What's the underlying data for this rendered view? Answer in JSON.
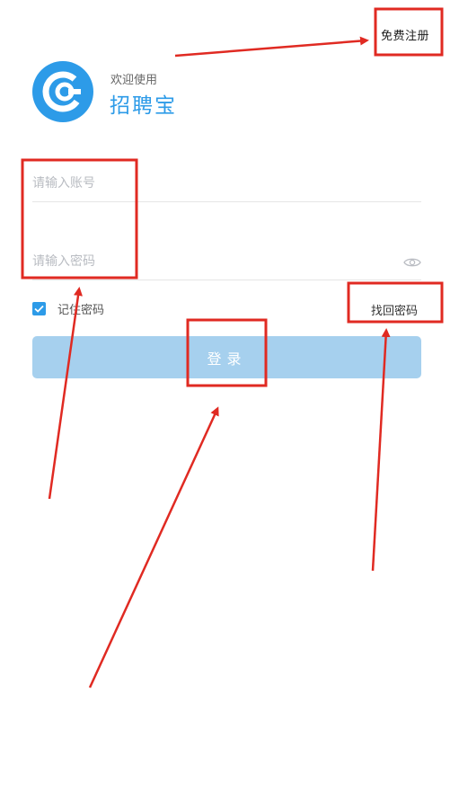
{
  "header": {
    "register_label": "免费注册"
  },
  "brand": {
    "welcome": "欢迎使用",
    "app_name": "招聘宝",
    "logo_icon": "app-logo-icon",
    "accent_color": "#2d9be8"
  },
  "form": {
    "account_placeholder": "请输入账号",
    "account_value": "",
    "password_placeholder": "请输入密码",
    "password_value": "",
    "password_toggle_icon": "eye-icon",
    "remember_label": "记住密码",
    "remember_checked": true,
    "forgot_label": "找回密码",
    "login_label": "登录",
    "login_button_color": "#a6d0ee"
  },
  "annotations": {
    "highlight_color": "#e02a22"
  }
}
